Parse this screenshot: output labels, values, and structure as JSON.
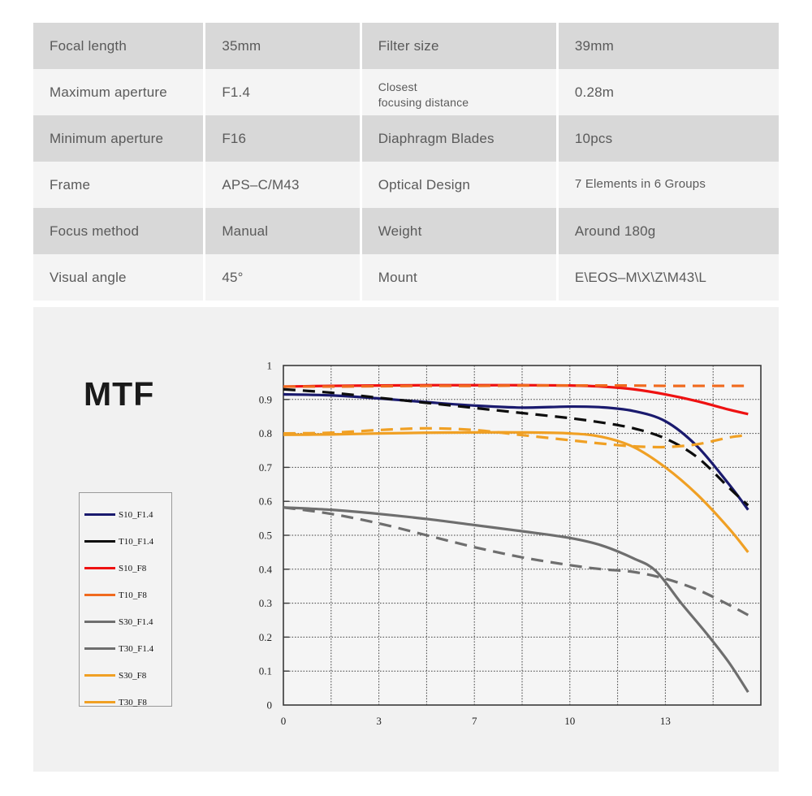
{
  "spec_table": {
    "rows": [
      {
        "label1": "Focal length",
        "value1": "35mm",
        "label2": "Filter size",
        "value2": "39mm",
        "shade": "dark"
      },
      {
        "label1": "Maximum aperture",
        "value1": "F1.4",
        "label2": "Closest\nfocusing distance",
        "value2": "0.28m",
        "shade": "light"
      },
      {
        "label1": "Minimum aperture",
        "value1": "F16",
        "label2": "Diaphragm Blades",
        "value2": "10pcs",
        "shade": "dark"
      },
      {
        "label1": "Frame",
        "value1": "APS–C/M43",
        "label2": "Optical Design",
        "value2": "7 Elements in 6 Groups",
        "shade": "light"
      },
      {
        "label1": "Focus method",
        "value1": "Manual",
        "label2": "Weight",
        "value2": "Around 180g",
        "shade": "dark"
      },
      {
        "label1": "Visual angle",
        "value1": "45°",
        "label2": "Mount",
        "value2": "E\\EOS–M\\X\\Z\\M43\\L",
        "shade": "light"
      }
    ]
  },
  "mtf": {
    "title": "MTF",
    "legend": [
      {
        "label": "S10_F1.4",
        "color": "#1a1a6e"
      },
      {
        "label": "T10_F1.4",
        "color": "#0d0d0d"
      },
      {
        "label": "S10_F8",
        "color": "#ee1111"
      },
      {
        "label": "T10_F8",
        "color": "#f06a1e"
      },
      {
        "label": "S30_F1.4",
        "color": "#6e6e6e"
      },
      {
        "label": "T30_F1.4",
        "color": "#6e6e6e"
      },
      {
        "label": "S30_F8",
        "color": "#f0a024"
      },
      {
        "label": "T30_F8",
        "color": "#f0a024"
      }
    ]
  },
  "chart_data": {
    "type": "line",
    "title": "MTF",
    "xlabel": "",
    "ylabel": "",
    "xlim": [
      0,
      15
    ],
    "ylim": [
      0,
      1
    ],
    "grid": true,
    "legend_position": "left",
    "y_ticks": [
      0,
      0.1,
      0.2,
      0.3,
      0.4,
      0.5,
      0.6,
      0.7,
      0.8,
      0.9,
      1
    ],
    "y_tick_labels": [
      "0",
      "0.1",
      "0.2",
      "0.3",
      "0.4",
      "0.5",
      "0.6",
      "0.7",
      "0.8",
      "0.9",
      "1"
    ],
    "x_ticks": [
      0,
      3,
      7,
      10,
      13
    ],
    "x_tick_labels": [
      "0",
      "3",
      "7",
      "10",
      "13"
    ],
    "x_gridline_count": 11,
    "series": [
      {
        "name": "S10_F1.4",
        "color": "#1a1a6e",
        "style": "solid",
        "x": [
          0,
          1.5,
          3,
          4.5,
          6,
          7.5,
          9,
          10,
          11,
          12,
          13,
          14,
          14.6
        ],
        "y": [
          0.915,
          0.912,
          0.903,
          0.892,
          0.882,
          0.876,
          0.879,
          0.877,
          0.866,
          0.836,
          0.762,
          0.65,
          0.575
        ]
      },
      {
        "name": "T10_F1.4",
        "color": "#0d0d0d",
        "style": "dashed",
        "x": [
          0,
          1.5,
          3,
          4.5,
          6,
          7.5,
          9,
          10,
          11,
          12,
          13,
          14,
          14.6
        ],
        "y": [
          0.93,
          0.92,
          0.905,
          0.89,
          0.875,
          0.86,
          0.845,
          0.832,
          0.815,
          0.785,
          0.73,
          0.64,
          0.588
        ]
      },
      {
        "name": "S10_F8",
        "color": "#ee1111",
        "style": "solid",
        "x": [
          0,
          1.5,
          3,
          4.5,
          6,
          7.5,
          9,
          10,
          11,
          12,
          13,
          14,
          14.6
        ],
        "y": [
          0.938,
          0.94,
          0.941,
          0.942,
          0.942,
          0.942,
          0.941,
          0.938,
          0.93,
          0.915,
          0.895,
          0.87,
          0.857
        ]
      },
      {
        "name": "T10_F8",
        "color": "#f06a1e",
        "style": "dashed",
        "x": [
          0,
          1.5,
          3,
          4.5,
          6,
          7.5,
          9,
          10,
          11,
          12,
          13,
          14,
          14.6
        ],
        "y": [
          0.938,
          0.938,
          0.939,
          0.94,
          0.94,
          0.941,
          0.941,
          0.941,
          0.941,
          0.94,
          0.94,
          0.94,
          0.94
        ]
      },
      {
        "name": "S30_F1.4",
        "color": "#6e6e6e",
        "style": "solid",
        "x": [
          0,
          1.5,
          3,
          4.5,
          6,
          7.5,
          9,
          10,
          11,
          11.7,
          12.5,
          13.3,
          14,
          14.6
        ],
        "y": [
          0.582,
          0.575,
          0.563,
          0.548,
          0.53,
          0.512,
          0.492,
          0.47,
          0.432,
          0.395,
          0.3,
          0.21,
          0.125,
          0.038
        ]
      },
      {
        "name": "T30_F1.4",
        "color": "#6e6e6e",
        "style": "dashed",
        "x": [
          0,
          1.5,
          3,
          4.5,
          6,
          7.5,
          9,
          10,
          11,
          12,
          13,
          14,
          14.6
        ],
        "y": [
          0.582,
          0.563,
          0.535,
          0.5,
          0.465,
          0.435,
          0.412,
          0.4,
          0.392,
          0.372,
          0.34,
          0.295,
          0.265
        ]
      },
      {
        "name": "S30_F8",
        "color": "#f0a024",
        "style": "solid",
        "x": [
          0,
          1.5,
          3,
          4.5,
          6,
          7.5,
          9,
          10,
          11,
          12,
          13,
          14,
          14.6
        ],
        "y": [
          0.796,
          0.797,
          0.8,
          0.802,
          0.803,
          0.803,
          0.8,
          0.79,
          0.76,
          0.7,
          0.62,
          0.52,
          0.45
        ]
      },
      {
        "name": "T30_F8",
        "color": "#f0a024",
        "style": "dashed",
        "x": [
          0,
          1.5,
          3,
          4.5,
          6,
          7.5,
          9,
          10,
          11,
          12,
          13,
          14,
          14.6
        ],
        "y": [
          0.8,
          0.802,
          0.81,
          0.815,
          0.81,
          0.795,
          0.78,
          0.77,
          0.762,
          0.76,
          0.768,
          0.788,
          0.795
        ]
      }
    ]
  }
}
